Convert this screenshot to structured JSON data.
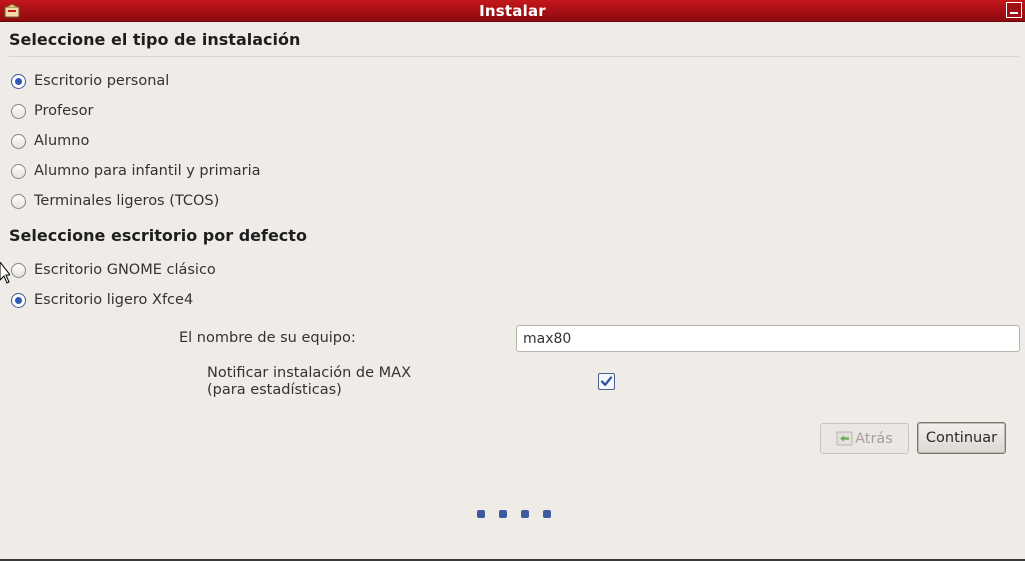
{
  "window": {
    "title": "Instalar"
  },
  "install_type": {
    "heading": "Seleccione el tipo de instalación",
    "options": [
      {
        "label": "Escritorio personal",
        "checked": true
      },
      {
        "label": "Profesor",
        "checked": false
      },
      {
        "label": "Alumno",
        "checked": false
      },
      {
        "label": "Alumno para infantil y primaria",
        "checked": false
      },
      {
        "label": "Terminales ligeros (TCOS)",
        "checked": false
      }
    ]
  },
  "desktop": {
    "heading": "Seleccione escritorio por defecto",
    "options": [
      {
        "label": "Escritorio GNOME clásico",
        "checked": false
      },
      {
        "label": "Escritorio ligero Xfce4",
        "checked": true
      }
    ]
  },
  "hostname": {
    "label": "El nombre de su equipo:",
    "value": "max80"
  },
  "notify": {
    "label_line1": "Notificar instalación de MAX",
    "label_line2": "(para estadísticas)",
    "checked": true
  },
  "buttons": {
    "back": "Atrás",
    "continue": "Continuar"
  },
  "colors": {
    "titlebar": "#c4161c",
    "accent": "#2f58b7"
  },
  "icons": {
    "app": "installer-icon",
    "minimize": "minimize-icon",
    "back": "back-arrow-icon",
    "check": "checkmark-icon"
  }
}
